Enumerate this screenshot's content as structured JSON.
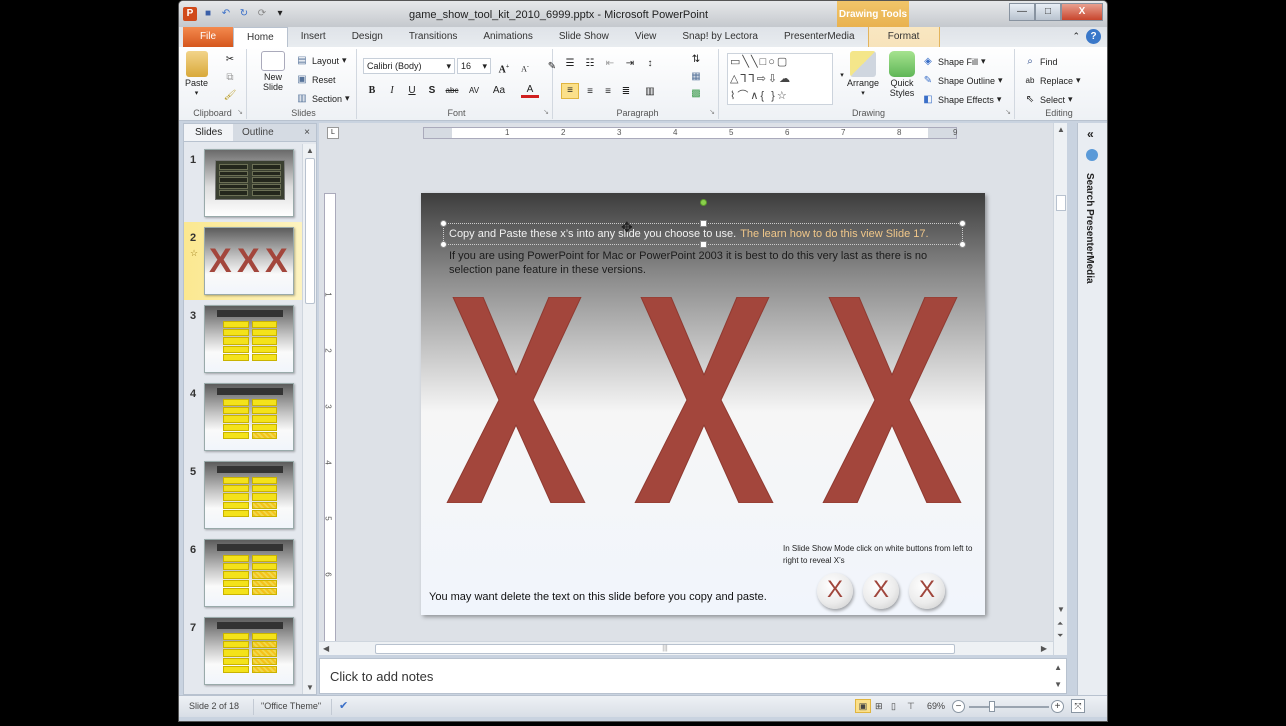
{
  "window": {
    "title": "game_show_tool_kit_2010_6999.pptx - Microsoft PowerPoint",
    "contextual_group": "Drawing Tools",
    "controls": {
      "minimize": "—",
      "maximize": "□",
      "close": "X"
    }
  },
  "quick_access": {
    "app_icon": "P",
    "save": "💾",
    "undo": "↶",
    "redo": "↻",
    "repeat": "⟳",
    "customize": "▾"
  },
  "tabs": [
    {
      "label": "File"
    },
    {
      "label": "Home"
    },
    {
      "label": "Insert"
    },
    {
      "label": "Design"
    },
    {
      "label": "Transitions"
    },
    {
      "label": "Animations"
    },
    {
      "label": "Slide Show"
    },
    {
      "label": "View"
    },
    {
      "label": "Snap! by Lectora"
    },
    {
      "label": "PresenterMedia"
    },
    {
      "label": "Format"
    }
  ],
  "active_tab": "Home",
  "ribbon": {
    "clipboard": {
      "label": "Clipboard",
      "paste": "Paste"
    },
    "slides": {
      "label": "Slides",
      "new_slide": "New Slide",
      "layout": "Layout",
      "reset": "Reset",
      "section": "Section"
    },
    "font": {
      "label": "Font",
      "font_name": "Calibri (Body)",
      "font_size": "16",
      "bold": "B",
      "italic": "I",
      "underline": "U",
      "shadow": "S",
      "strike": "abc",
      "spacing": "AV",
      "case": "Aa",
      "color": "A"
    },
    "paragraph": {
      "label": "Paragraph"
    },
    "drawing": {
      "label": "Drawing",
      "arrange": "Arrange",
      "quick_styles": "Quick Styles",
      "shape_fill": "Shape Fill",
      "shape_outline": "Shape Outline",
      "shape_effects": "Shape Effects"
    },
    "editing": {
      "label": "Editing",
      "find": "Find",
      "replace": "Replace",
      "select": "Select"
    }
  },
  "slides_panel": {
    "tabs": [
      "Slides",
      "Outline"
    ],
    "close": "×",
    "thumbnails": [
      {
        "number": "1",
        "title": ""
      },
      {
        "number": "2",
        "title": "",
        "selected": true
      },
      {
        "number": "3",
        "title": "Ten Panel Board"
      },
      {
        "number": "4",
        "title": "Nine Panel Board"
      },
      {
        "number": "5",
        "title": "Eight Panel Board"
      },
      {
        "number": "6",
        "title": "Seven Panel Board"
      },
      {
        "number": "7",
        "title": "Six Panel Board"
      }
    ]
  },
  "ruler": {
    "h_numbers": [
      "1",
      "2",
      "3",
      "4",
      "5",
      "6",
      "7",
      "8",
      "9"
    ],
    "v_numbers": [
      "1",
      "2",
      "3",
      "4",
      "5",
      "6"
    ]
  },
  "slide": {
    "line1": "Copy and Paste these x’s into any slide you choose to use.",
    "line1_highlight": "The learn how to do this view Slide 17.",
    "line2": "If you are using  PowerPoint for Mac or PowerPoint 2003 it is best to do this very last as there is no selection pane feature in these versions.",
    "big_x_count": 3,
    "instruction": "In Slide Show Mode click on white buttons  from left to right to reveal X’s",
    "bottom_text": "You may want delete the text on this slide before you copy and paste.",
    "buttons": [
      "X",
      "X",
      "X"
    ],
    "colors": {
      "x_red": "#a3463c",
      "highlight": "#f0c78a"
    }
  },
  "notes": {
    "placeholder": "Click to add notes"
  },
  "side_pane": {
    "title": "Search PresenterMedia",
    "collapse": "«"
  },
  "status": {
    "slide_info": "Slide 2 of 18",
    "theme": "\"Office Theme\"",
    "zoom": "69%",
    "zoom_value": 69
  }
}
